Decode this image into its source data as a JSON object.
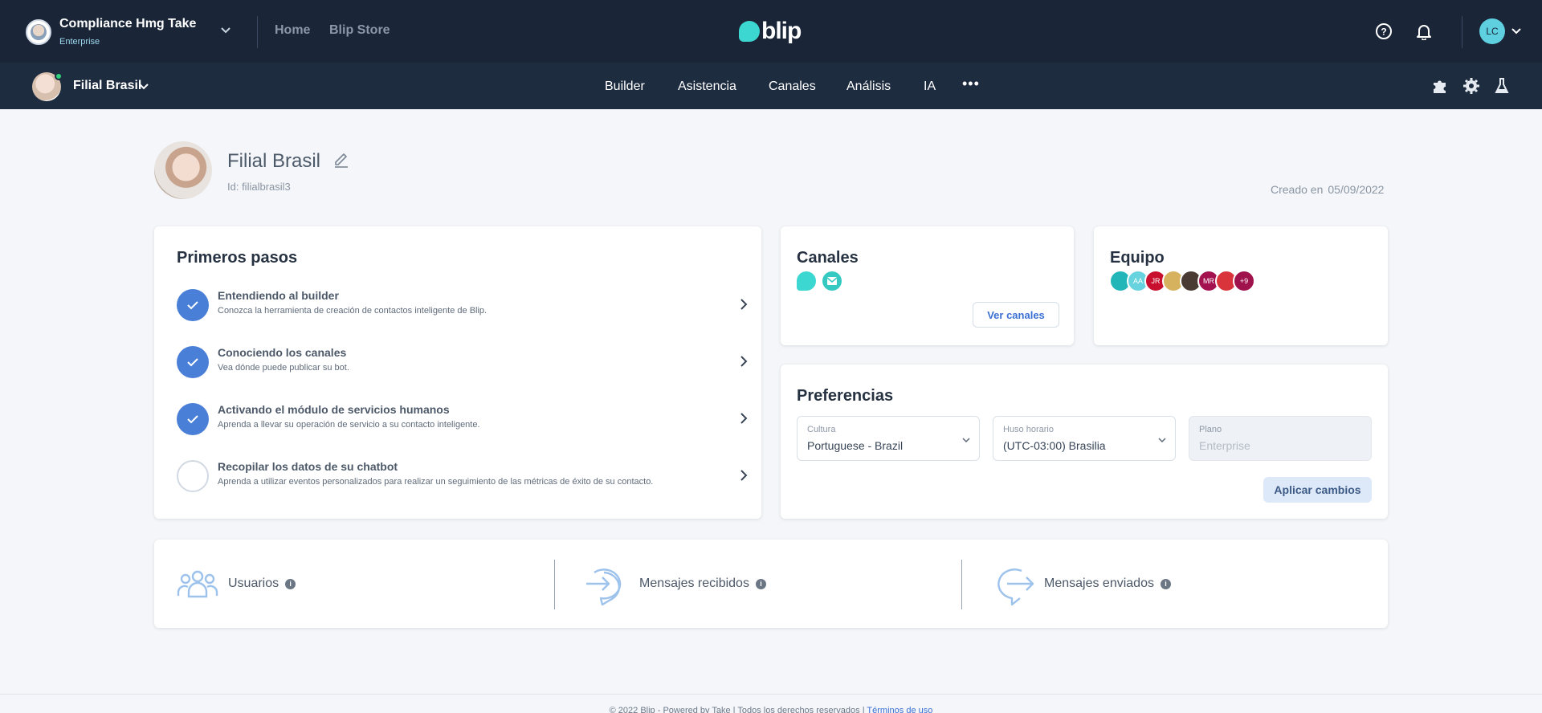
{
  "topbar": {
    "org_name": "Compliance Hmg Take",
    "org_plan": "Enterprise",
    "links": [
      "Home",
      "Blip Store"
    ],
    "logo_text": "blip",
    "user_initials": "LC"
  },
  "subnav": {
    "bot_name": "Filial Brasil",
    "items": [
      "Builder",
      "Asistencia",
      "Canales",
      "Análisis",
      "IA"
    ],
    "more": "•••"
  },
  "header": {
    "title": "Filial Brasil",
    "id_text": "Id: filialbrasil3",
    "created_label": "Creado en",
    "created_date": "05/09/2022"
  },
  "first_steps": {
    "title": "Primeros pasos",
    "steps": [
      {
        "title": "Entendiendo al builder",
        "desc": "Conozca la herramienta de creación de contactos inteligente de Blip.",
        "done": true
      },
      {
        "title": "Conociendo los canales",
        "desc": "Vea dónde puede publicar su bot.",
        "done": true
      },
      {
        "title": "Activando el módulo de servicios humanos",
        "desc": "Aprenda a llevar su operación de servicio a su contacto inteligente.",
        "done": true
      },
      {
        "title": "Recopilar los datos de su chatbot",
        "desc": "Aprenda a utilizar eventos personalizados para realizar un seguimiento de las métricas de éxito de su contacto.",
        "done": false
      }
    ]
  },
  "channels": {
    "title": "Canales",
    "button": "Ver canales"
  },
  "team": {
    "title": "Equipo",
    "members": [
      "",
      "AA",
      "JR",
      "",
      "",
      "MR",
      "",
      "+9"
    ]
  },
  "preferences": {
    "title": "Preferencias",
    "culture_label": "Cultura",
    "culture_value": "Portuguese - Brazil",
    "timezone_label": "Huso horario",
    "timezone_value": "(UTC-03:00) Brasilia",
    "plan_label": "Plano",
    "plan_value": "Enterprise",
    "apply": "Aplicar cambios"
  },
  "stats": {
    "users": "Usuarios",
    "received": "Mensajes recibidos",
    "sent": "Mensajes enviados"
  },
  "footer": {
    "text": "© 2022 Blip - Powered by Take | Todos los derechos reservados |",
    "link": "Términos de uso"
  },
  "colors": {
    "topbar": "#1a2638",
    "accent": "#4a7fd8",
    "brand": "#3bd7d0"
  }
}
